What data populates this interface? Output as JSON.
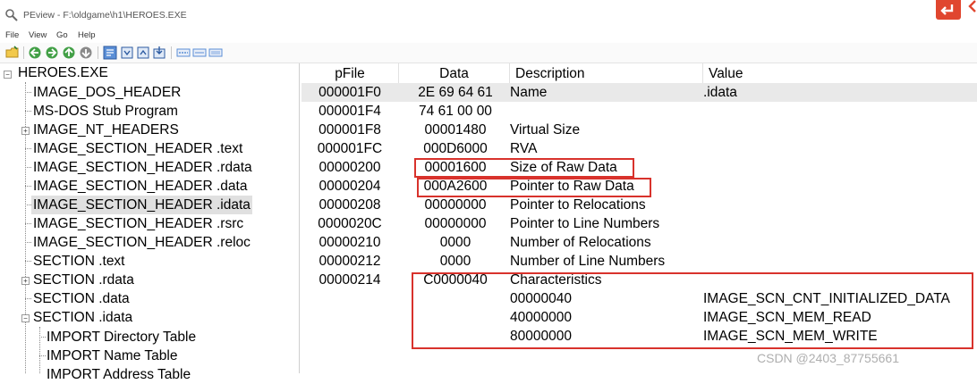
{
  "window": {
    "title": "PEview - F:\\oldgame\\h1\\HEROES.EXE"
  },
  "menu": [
    "File",
    "View",
    "Go",
    "Help"
  ],
  "toolbar": {
    "icons": [
      "open-folder-icon",
      "back-icon",
      "forward-icon",
      "up-icon",
      "down-icon",
      "stop-icon",
      "view-hex-icon",
      "view-text-icon",
      "view-struct-icon",
      "view-export-icon",
      "layout-a-icon",
      "layout-b-icon",
      "layout-c-icon"
    ]
  },
  "tree": {
    "root": "HEROES.EXE",
    "items": [
      {
        "label": "IMAGE_DOS_HEADER"
      },
      {
        "label": "MS-DOS Stub Program"
      },
      {
        "label": "IMAGE_NT_HEADERS"
      },
      {
        "label": "IMAGE_SECTION_HEADER .text"
      },
      {
        "label": "IMAGE_SECTION_HEADER .rdata"
      },
      {
        "label": "IMAGE_SECTION_HEADER .data"
      },
      {
        "label": "IMAGE_SECTION_HEADER .idata"
      },
      {
        "label": "IMAGE_SECTION_HEADER .rsrc"
      },
      {
        "label": "IMAGE_SECTION_HEADER .reloc"
      },
      {
        "label": "SECTION .text"
      },
      {
        "label": "SECTION .rdata"
      },
      {
        "label": "SECTION .data"
      },
      {
        "label": "SECTION .idata"
      },
      {
        "label": "IMPORT Directory Table"
      },
      {
        "label": "IMPORT Name Table"
      },
      {
        "label": "IMPORT Address Table"
      }
    ]
  },
  "table": {
    "columns": [
      "pFile",
      "Data",
      "Description",
      "Value"
    ],
    "rows": [
      {
        "pfile": "000001F0",
        "data": "2E 69 64 61",
        "desc": "Name",
        "value": ".idata"
      },
      {
        "pfile": "000001F4",
        "data": "74 61 00 00",
        "desc": "",
        "value": ""
      },
      {
        "pfile": "000001F8",
        "data": "00001480",
        "desc": "Virtual Size",
        "value": ""
      },
      {
        "pfile": "000001FC",
        "data": "000D6000",
        "desc": "RVA",
        "value": ""
      },
      {
        "pfile": "00000200",
        "data": "00001600",
        "desc": "Size of Raw Data",
        "value": ""
      },
      {
        "pfile": "00000204",
        "data": "000A2600",
        "desc": "Pointer to Raw Data",
        "value": ""
      },
      {
        "pfile": "00000208",
        "data": "00000000",
        "desc": "Pointer to Relocations",
        "value": ""
      },
      {
        "pfile": "0000020C",
        "data": "00000000",
        "desc": "Pointer to Line Numbers",
        "value": ""
      },
      {
        "pfile": "00000210",
        "data": "0000",
        "desc": "Number of Relocations",
        "value": ""
      },
      {
        "pfile": "00000212",
        "data": "0000",
        "desc": "Number of Line Numbers",
        "value": ""
      },
      {
        "pfile": "00000214",
        "data": "C0000040",
        "desc": "Characteristics",
        "value": ""
      },
      {
        "pfile": "",
        "data": "",
        "desc": "00000040",
        "value": "IMAGE_SCN_CNT_INITIALIZED_DATA"
      },
      {
        "pfile": "",
        "data": "",
        "desc": "40000000",
        "value": "IMAGE_SCN_MEM_READ"
      },
      {
        "pfile": "",
        "data": "",
        "desc": "80000000",
        "value": "IMAGE_SCN_MEM_WRITE"
      }
    ]
  },
  "watermark": "CSDN @2403_87755661",
  "colors": {
    "annotation": "#d8322c",
    "selection": "#e0e0e0",
    "corner_button": "#e0462f"
  }
}
